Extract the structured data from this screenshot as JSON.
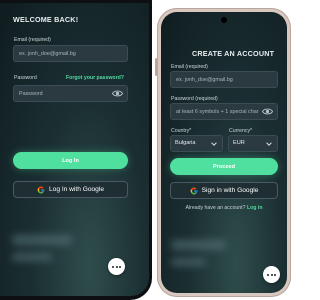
{
  "left_screen": {
    "title": "WELCOME BACK!",
    "email_label": "Email (required)",
    "email_placeholder": "ex. jonh_doe@gmail.bg",
    "password_label": "Password",
    "forgot_link": "Forgot your password?",
    "password_placeholder": "Password",
    "login_button": "Log In",
    "google_button": "Log In with Google",
    "eye_icon": "eye-icon",
    "google_icon": "google-g-icon",
    "chat_icon": "chat-bubble-icon"
  },
  "right_screen": {
    "title": "CREATE AN ACCOUNT",
    "email_label": "Email (required)",
    "email_placeholder": "ex. jonh_doe@gmail.bg",
    "password_label": "Password (required)",
    "password_placeholder": "at least 6 symbols + 1 special char",
    "country_label": "Country*",
    "country_value": "Bulgaria",
    "currency_label": "Currency*",
    "currency_value": "EUR",
    "proceed_button": "Proceed",
    "google_button": "Sign in with Google",
    "have_account_text": "Already have an account?",
    "login_link": "Log in",
    "eye_icon": "eye-icon",
    "google_icon": "google-g-icon",
    "chat_icon": "chat-bubble-icon"
  },
  "colors": {
    "accent": "#4fe0a0",
    "link": "#53d9a0",
    "background_dark": "#1b2f32",
    "field_bg": "#2a3a40",
    "phone_frame_right": "#d9c8bf"
  }
}
